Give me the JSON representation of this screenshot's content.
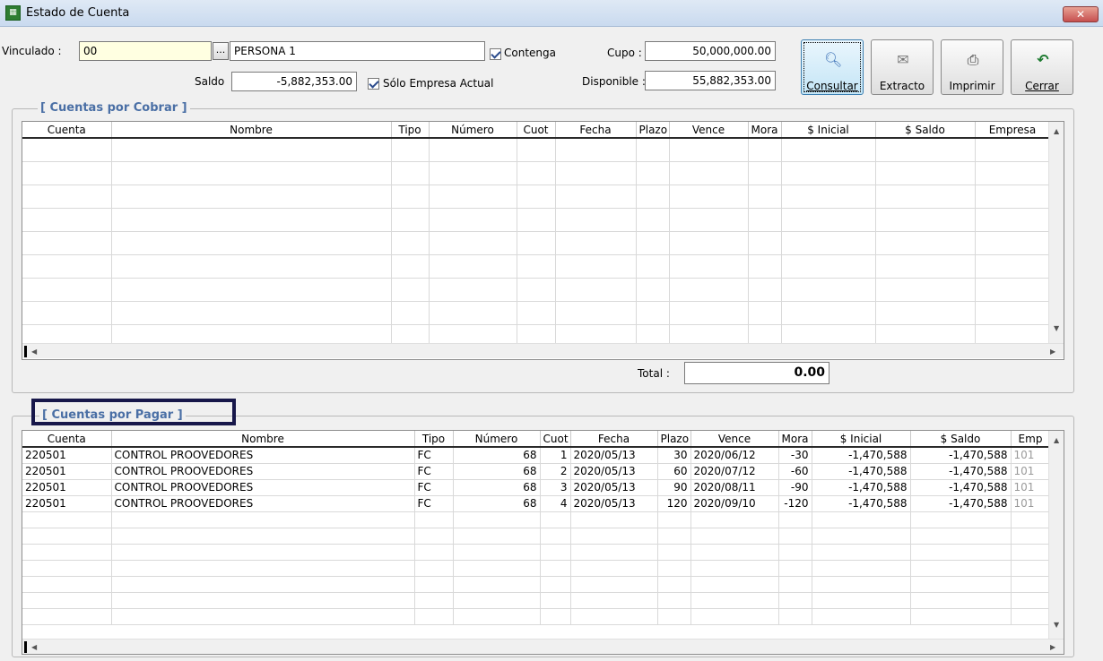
{
  "window": {
    "title": "Estado de Cuenta",
    "close_label": "✕"
  },
  "header": {
    "vinculado_label": "Vinculado :",
    "vinculado_value": "00",
    "lookup_label": "...",
    "persona_value": "PERSONA 1",
    "contenga_label": "Contenga",
    "saldo_label": "Saldo",
    "saldo_value": "-5,882,353.00",
    "solo_empresa_label": "Sólo Empresa Actual",
    "cupo_label": "Cupo :",
    "cupo_value": "50,000,000.00",
    "disponible_label": "Disponible :",
    "disponible_value": "55,882,353.00"
  },
  "toolbar": {
    "consultar_label": "Consultar",
    "extracto_label": "Extracto",
    "imprimir_label": "Imprimir",
    "cerrar_label": "Cerrar"
  },
  "cobrar": {
    "title": "[ Cuentas por Cobrar ]",
    "columns": [
      "Cuenta",
      "Nombre",
      "Tipo",
      "Número",
      "Cuot",
      "Fecha",
      "Plazo",
      "Vence",
      "Mora",
      "$ Inicial",
      "$ Saldo",
      "Empresa"
    ],
    "total_label": "Total :",
    "total_value": "0.00"
  },
  "pagar": {
    "title": "[ Cuentas por Pagar ]",
    "columns": [
      "Cuenta",
      "Nombre",
      "Tipo",
      "Número",
      "Cuot",
      "Fecha",
      "Plazo",
      "Vence",
      "Mora",
      "$ Inicial",
      "$ Saldo",
      "Emp"
    ],
    "rows": [
      [
        "220501",
        "CONTROL PROOVEDORES",
        "FC",
        "68",
        "1",
        "2020/05/13",
        "30",
        "2020/06/12",
        "-30",
        "-1,470,588",
        "-1,470,588",
        "101"
      ],
      [
        "220501",
        "CONTROL PROOVEDORES",
        "FC",
        "68",
        "2",
        "2020/05/13",
        "60",
        "2020/07/12",
        "-60",
        "-1,470,588",
        "-1,470,588",
        "101"
      ],
      [
        "220501",
        "CONTROL PROOVEDORES",
        "FC",
        "68",
        "3",
        "2020/05/13",
        "90",
        "2020/08/11",
        "-90",
        "-1,470,588",
        "-1,470,588",
        "101"
      ],
      [
        "220501",
        "CONTROL PROOVEDORES",
        "FC",
        "68",
        "4",
        "2020/05/13",
        "120",
        "2020/09/10",
        "-120",
        "-1,470,588",
        "-1,470,588",
        "101"
      ]
    ]
  },
  "icons": {
    "app": "spreadsheet-icon",
    "consultar": "magnifier-icon",
    "extracto": "document-icon",
    "imprimir": "printer-icon",
    "cerrar": "undo-arrow-icon"
  }
}
